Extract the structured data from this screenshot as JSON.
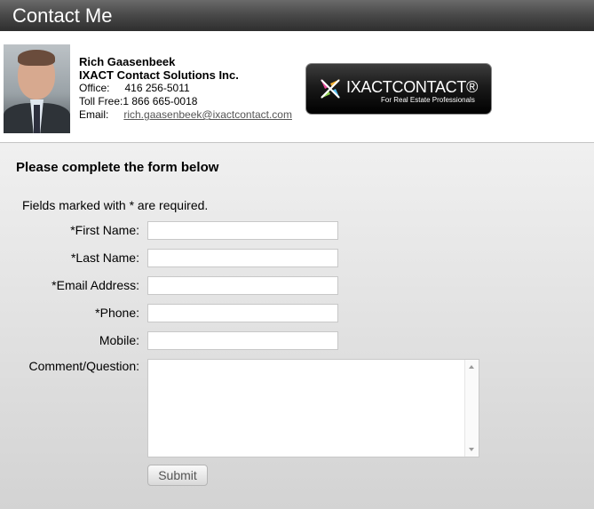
{
  "title": "Contact Me",
  "contact": {
    "name": "Rich Gaasenbeek",
    "company": "IXACT Contact Solutions Inc.",
    "office_label": "Office:",
    "office_value": "416 256-5011",
    "tollfree_label": "Toll Free:",
    "tollfree_value": "1 866 665-0018",
    "email_label": "Email:",
    "email_value": "rich.gaasenbeek@ixactcontact.com"
  },
  "logo": {
    "brand": "IXACTCONTACT®",
    "tagline": "For Real Estate Professionals"
  },
  "form": {
    "heading": "Please complete the form below",
    "required_note": "Fields marked with * are required.",
    "fields": [
      {
        "label": "*First Name:",
        "value": ""
      },
      {
        "label": "*Last Name:",
        "value": ""
      },
      {
        "label": "*Email Address:",
        "value": ""
      },
      {
        "label": "*Phone:",
        "value": ""
      },
      {
        "label": "Mobile:",
        "value": ""
      }
    ],
    "comment_label": "Comment/Question:",
    "comment_value": "",
    "submit_label": "Submit"
  }
}
